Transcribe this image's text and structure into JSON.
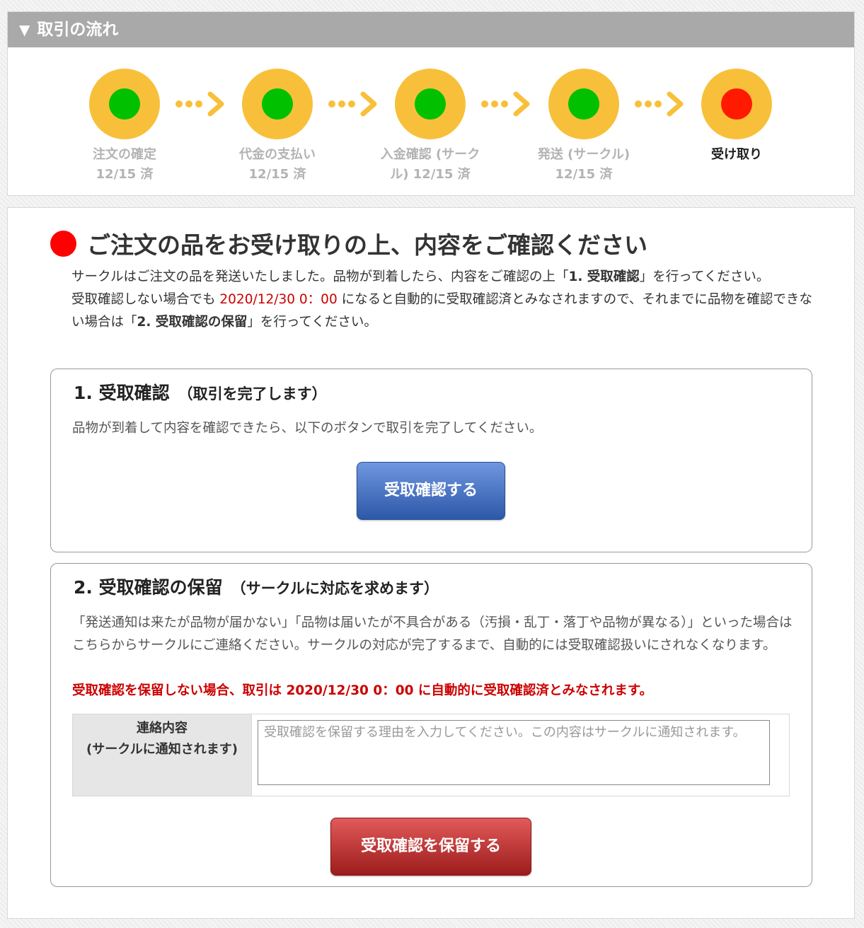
{
  "flow": {
    "header": "取引の流れ",
    "header_icon": "▼",
    "steps": [
      {
        "line1": "注文の確定",
        "line2": "12/15 済",
        "status": "done",
        "color": "#00c000"
      },
      {
        "line1": "代金の支払い",
        "line2": "12/15 済",
        "status": "done",
        "color": "#00c000"
      },
      {
        "line1": "入金確認 (サーク",
        "line2": "ル) 12/15 済",
        "status": "done",
        "color": "#00c000"
      },
      {
        "line1": "発送 (サークル)",
        "line2": "12/15 済",
        "status": "done",
        "color": "#00c000"
      },
      {
        "line1": "受け取り",
        "line2": "",
        "status": "current",
        "color": "#ff1a00"
      }
    ]
  },
  "main": {
    "title": "ご注文の品をお受け取りの上、内容をご確認ください",
    "intro": {
      "p1_a": "サークルはご注文の品を発送いたしました。品物が到着したら、内容をご確認の上「",
      "p1_b": "1. 受取確認",
      "p1_c": "」を行ってください。",
      "p2_a": "受取確認しない場合でも ",
      "p2_date": "2020/12/30 0：00",
      "p2_b": " になると自動的に受取確認済とみなされますので、それまでに品物を確認できない場合は「",
      "p2_c": "2. 受取確認の保留",
      "p2_d": "」を行ってください。"
    },
    "box1": {
      "title": "1. 受取確認",
      "subtitle": "（取引を完了します）",
      "text": "品物が到着して内容を確認できたら、以下のボタンで取引を完了してください。",
      "button": "受取確認する"
    },
    "box2": {
      "title": "2. 受取確認の保留",
      "subtitle": "（サークルに対応を求めます）",
      "text": "「発送通知は来たが品物が届かない」「品物は届いたが不具合がある（汚損・乱丁・落丁や品物が異なる）」といった場合はこちらからサークルにご連絡ください。サークルの対応が完了するまで、自動的には受取確認扱いにされなくなります。",
      "warning": "受取確認を保留しない場合、取引は 2020/12/30 0：00 に自動的に受取確認済とみなされます。",
      "form_label_1": "連絡内容",
      "form_label_2": "(サークルに通知されます)",
      "placeholder": "受取確認を保留する理由を入力してください。この内容はサークルに通知されます。",
      "button": "受取確認を保留する"
    }
  },
  "colors": {
    "header_gray": "#a9a9a9",
    "step_ring": "#f8c03a",
    "done_dot": "#00c000",
    "current_dot": "#ff1a00",
    "warning_red": "#cc0000",
    "confirm_blue": "#2d58a8",
    "hold_red": "#9c1c1c"
  }
}
